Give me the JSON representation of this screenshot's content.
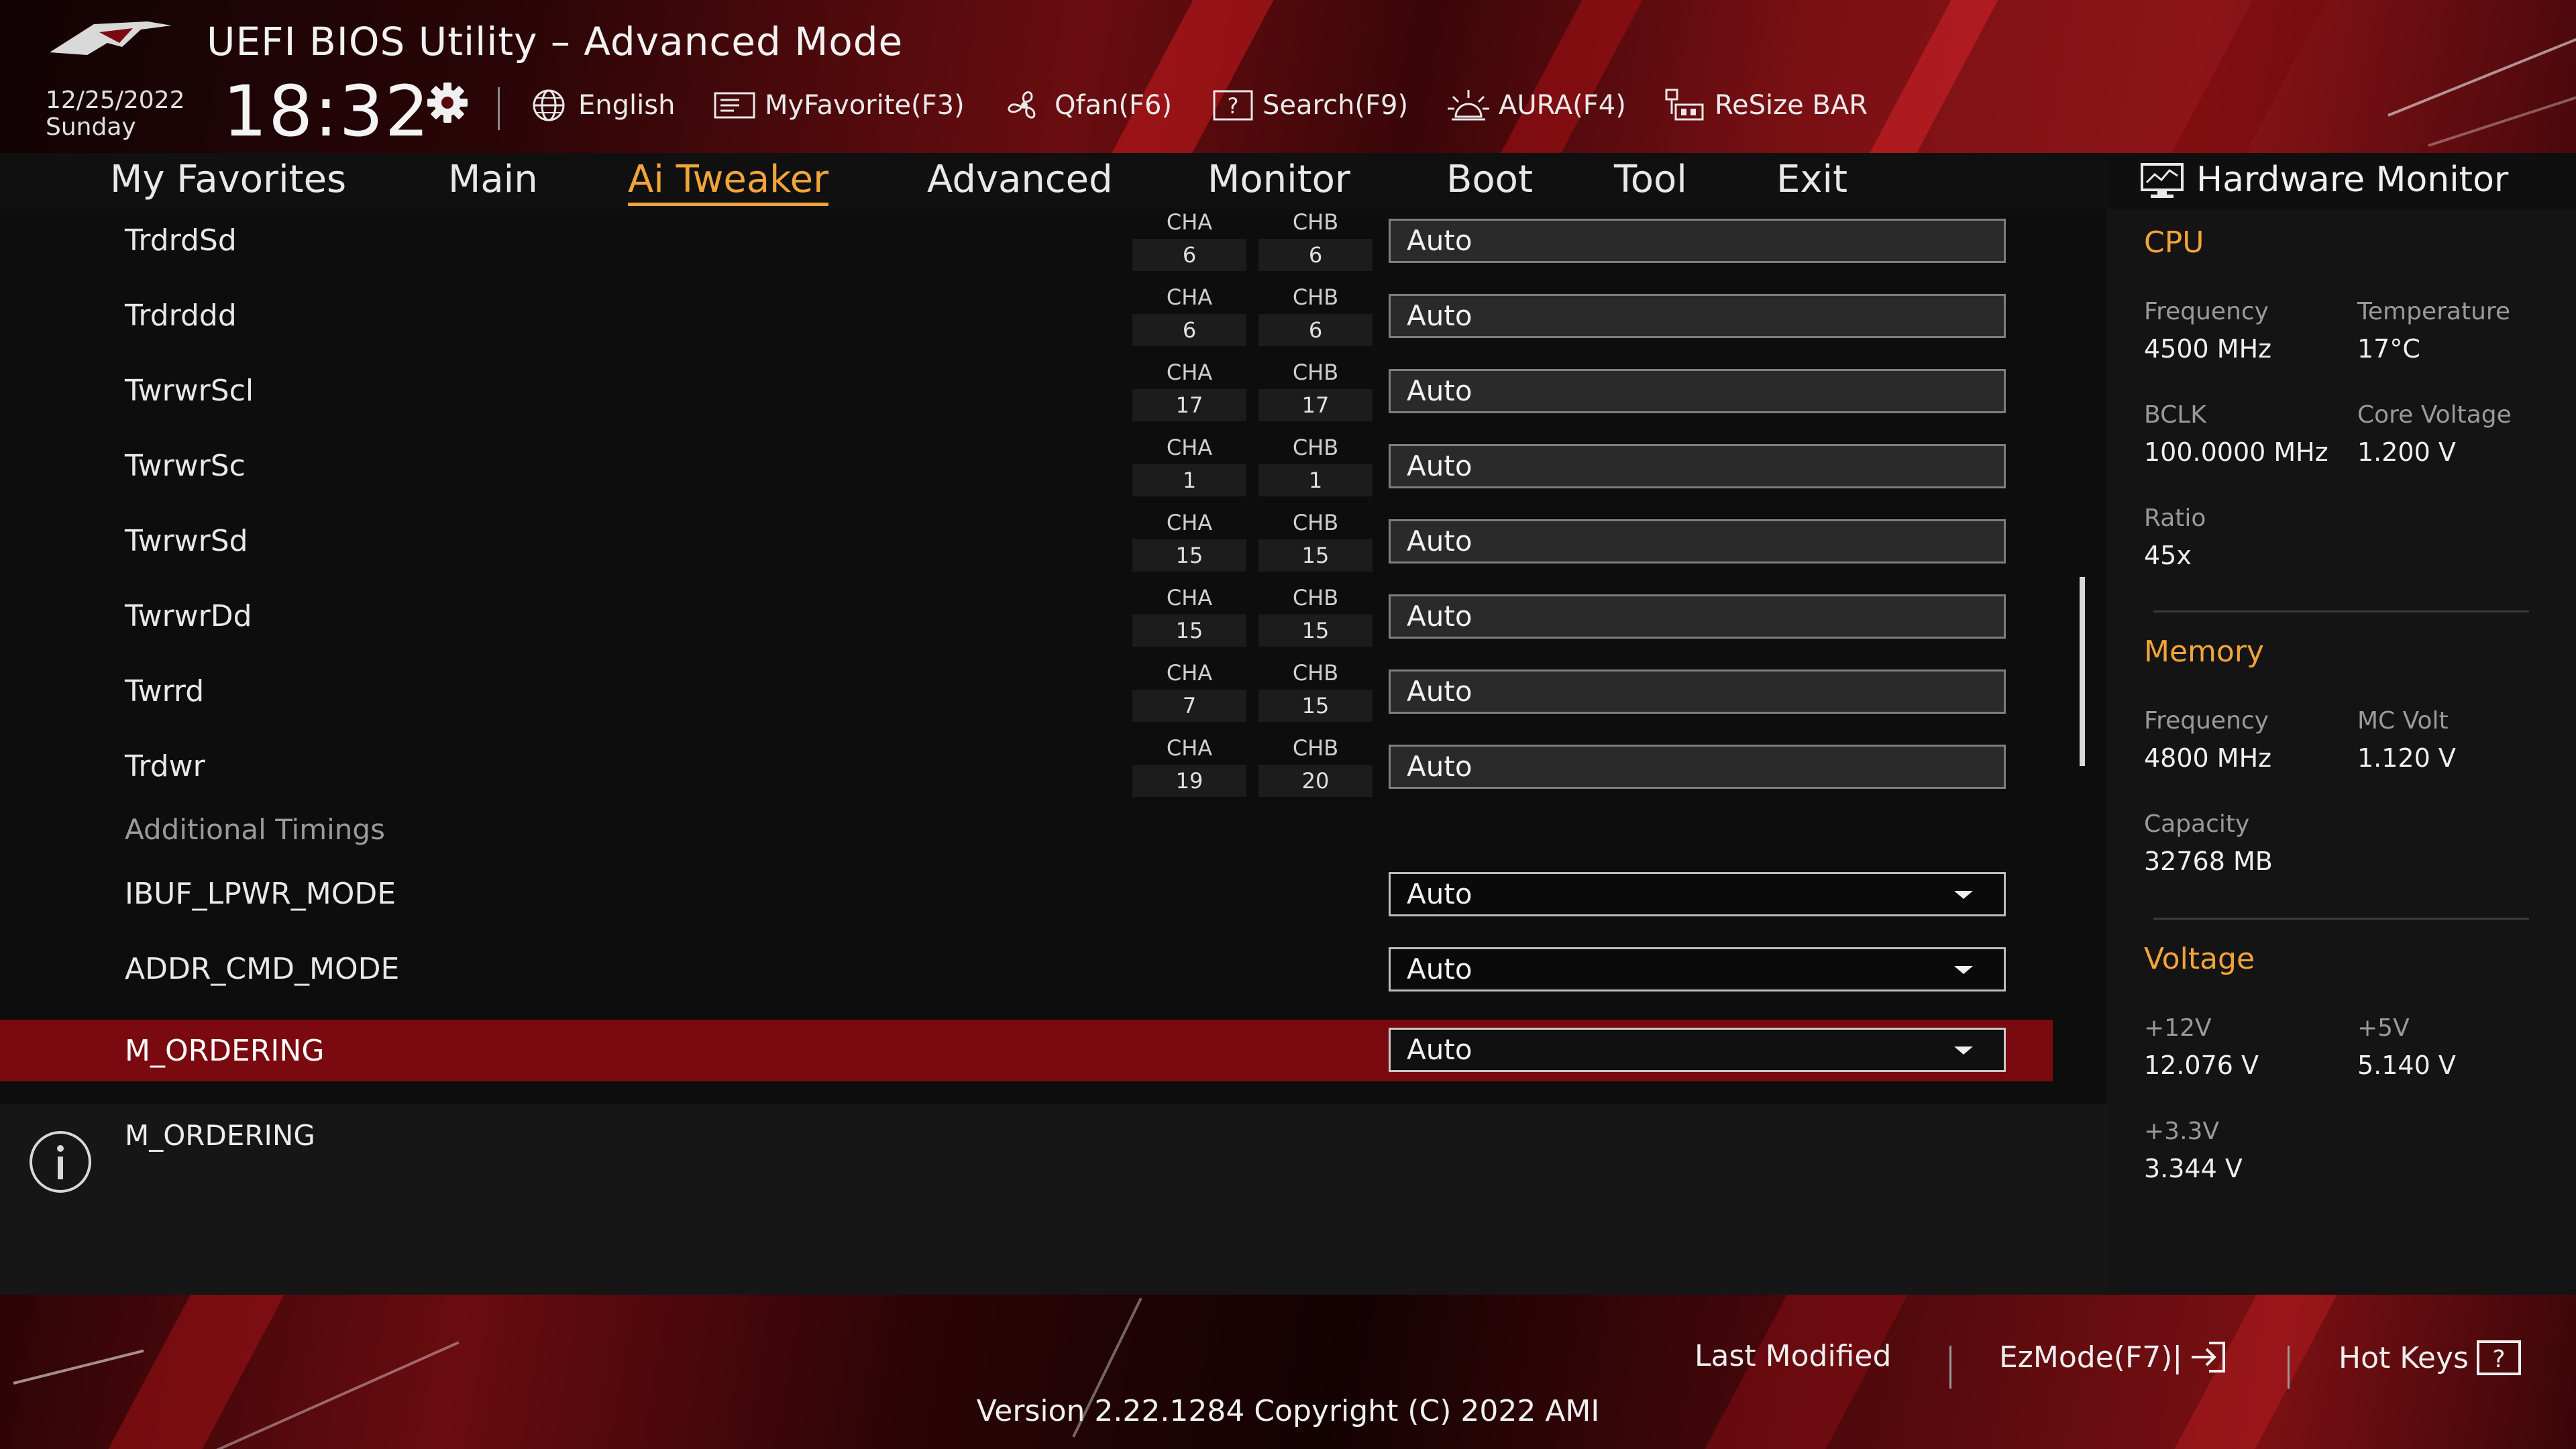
{
  "header": {
    "title": "UEFI BIOS Utility – Advanced Mode",
    "date": "12/25/2022",
    "day": "Sunday",
    "time": "18:32",
    "tools": [
      {
        "label": "English",
        "icon": "globe-icon"
      },
      {
        "label": "MyFavorite(F3)",
        "icon": "favorite-icon"
      },
      {
        "label": "Qfan(F6)",
        "icon": "fan-icon"
      },
      {
        "label": "Search(F9)",
        "icon": "search-help-icon"
      },
      {
        "label": "AURA(F4)",
        "icon": "aura-light-icon"
      },
      {
        "label": "ReSize BAR",
        "icon": "resize-bar-icon"
      }
    ]
  },
  "nav": {
    "tabs": [
      "My Favorites",
      "Main",
      "Ai Tweaker",
      "Advanced",
      "Monitor",
      "Boot",
      "Tool",
      "Exit"
    ],
    "active": "Ai Tweaker"
  },
  "timings": {
    "cha_label": "CHA",
    "chb_label": "CHB",
    "rows": [
      {
        "name": "TrdrdSd",
        "cha": "6",
        "chb": "6",
        "value": "Auto"
      },
      {
        "name": "Trdrddd",
        "cha": "6",
        "chb": "6",
        "value": "Auto"
      },
      {
        "name": "TwrwrScl",
        "cha": "17",
        "chb": "17",
        "value": "Auto"
      },
      {
        "name": "TwrwrSc",
        "cha": "1",
        "chb": "1",
        "value": "Auto"
      },
      {
        "name": "TwrwrSd",
        "cha": "15",
        "chb": "15",
        "value": "Auto"
      },
      {
        "name": "TwrwrDd",
        "cha": "15",
        "chb": "15",
        "value": "Auto"
      },
      {
        "name": "Twrrd",
        "cha": "7",
        "chb": "15",
        "value": "Auto"
      },
      {
        "name": "Trdwr",
        "cha": "19",
        "chb": "20",
        "value": "Auto"
      }
    ]
  },
  "additional": {
    "header": "Additional Timings",
    "rows": [
      {
        "name": "IBUF_LPWR_MODE",
        "value": "Auto"
      },
      {
        "name": "ADDR_CMD_MODE",
        "value": "Auto"
      },
      {
        "name": "M_ORDERING",
        "value": "Auto"
      }
    ],
    "selected": "M_ORDERING"
  },
  "info": {
    "text": "M_ORDERING"
  },
  "hwmon": {
    "title": "Hardware Monitor",
    "cpu": {
      "title": "CPU",
      "frequency_label": "Frequency",
      "frequency": "4500 MHz",
      "temperature_label": "Temperature",
      "temperature": "17°C",
      "bclk_label": "BCLK",
      "bclk": "100.0000 MHz",
      "core_voltage_label": "Core Voltage",
      "core_voltage": "1.200 V",
      "ratio_label": "Ratio",
      "ratio": "45x"
    },
    "memory": {
      "title": "Memory",
      "frequency_label": "Frequency",
      "frequency": "4800 MHz",
      "mc_volt_label": "MC Volt",
      "mc_volt": "1.120 V",
      "capacity_label": "Capacity",
      "capacity": "32768 MB"
    },
    "voltage": {
      "title": "Voltage",
      "v12_label": "+12V",
      "v12": "12.076 V",
      "v5_label": "+5V",
      "v5": "5.140 V",
      "v33_label": "+3.3V",
      "v33": "3.344 V"
    }
  },
  "footer": {
    "last_modified": "Last Modified",
    "ezmode": "EzMode(F7)|",
    "hotkeys": "Hot Keys",
    "version": "Version 2.22.1284 Copyright (C) 2022 AMI"
  },
  "colors": {
    "accent": "#f2a43a",
    "selected_row": "#7a0a0f",
    "header_red": "#8d1418",
    "background": "#0d0d0d"
  }
}
